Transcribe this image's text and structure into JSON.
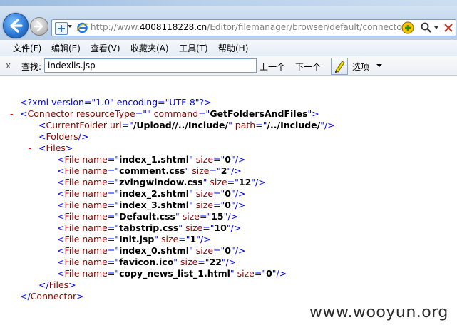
{
  "browser": {
    "address_url_prefix": "http://www.",
    "address_url_domain": "4008118228.cn",
    "address_url_path": "/Editor/filemanager/browser/default/connectors"
  },
  "menu": [
    {
      "label": "文件(F)"
    },
    {
      "label": "编辑(E)"
    },
    {
      "label": "查看(V)"
    },
    {
      "label": "收藏夹(A)"
    },
    {
      "label": "工具(T)"
    },
    {
      "label": "帮助(H)"
    }
  ],
  "find_bar": {
    "close_label": "x",
    "label": "查找:",
    "value": "indexlis.jsp",
    "prev_label": "上一个",
    "next_label": "下一个",
    "options_label": "选项"
  },
  "xml": {
    "declaration": "<?xml version=\"1.0\" encoding=\"UTF-8\"?>",
    "collapse_marker": "-",
    "connector": {
      "resourceType": "",
      "command": "GetFoldersAndFiles"
    },
    "current_folder": {
      "url": "/Upload//../Include/",
      "path": "/../Include/"
    },
    "files": [
      {
        "name": "index_1.shtml",
        "size": "0"
      },
      {
        "name": "comment.css",
        "size": "2"
      },
      {
        "name": "zvingwindow.css",
        "size": "12"
      },
      {
        "name": "index_2.shtml",
        "size": "0"
      },
      {
        "name": "index_3.shtml",
        "size": "0"
      },
      {
        "name": "Default.css",
        "size": "15"
      },
      {
        "name": "tabstrip.css",
        "size": "10"
      },
      {
        "name": "Init.jsp",
        "size": "1"
      },
      {
        "name": "index_0.shtml",
        "size": "0"
      },
      {
        "name": "favicon.ico",
        "size": "22"
      },
      {
        "name": "copy_news_list_1.html",
        "size": "0"
      }
    ]
  },
  "watermark": "www.wooyun.org",
  "colors": {
    "tag": "#990000",
    "markup": "#0000ff",
    "value": "#000000",
    "collapse": "#ff0000"
  },
  "icons": {
    "back": "arrow-left-icon",
    "forward": "arrow-right-icon",
    "favorites": "add-favorite-icon",
    "page": "ie-page-icon",
    "compat": "compatibility-view-icon",
    "search": "magnifier-icon",
    "close": "close-icon",
    "highlight": "highlighter-icon"
  }
}
